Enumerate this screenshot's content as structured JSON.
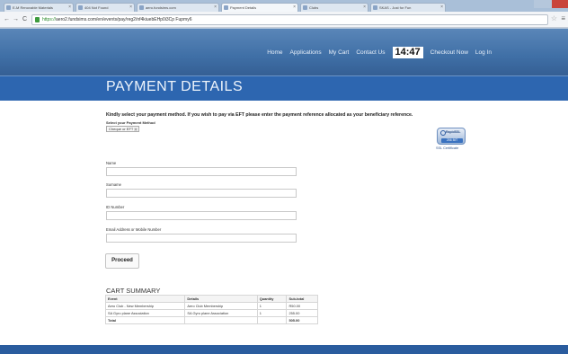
{
  "browser": {
    "tabs": [
      {
        "label": "E-M Renovable Materials",
        "active": false
      },
      {
        "label": "404 Not Found",
        "active": false
      },
      {
        "label": "aero.fundsims.com",
        "active": false
      },
      {
        "label": "Payment Details",
        "active": true
      },
      {
        "label": "Clubs",
        "active": false
      },
      {
        "label": "SKAS - Just for Fun",
        "active": false
      }
    ],
    "url_scheme": "https://",
    "url_rest": "aero2.fundsims.com/en/events/pay/reg2/nf4kiuebEHp0i3Cp Fupmy6",
    "back": "←",
    "forward": "→",
    "reload": "C"
  },
  "site": {
    "nav": [
      "Home",
      "Applications",
      "My Cart",
      "Contact Us"
    ],
    "clock": "14:47",
    "nav_after": [
      "Checkout Now",
      "Log In"
    ]
  },
  "page": {
    "title": "PAYMENT DETAILS",
    "intro": "Kindly select your payment method. If you wish to pay via EFT please enter the payment reference allocated as your beneficiary reference.",
    "select_label": "Select your Payment Method",
    "select_value": "Cheque or EFT",
    "ssl_caption": "SSL Certificate",
    "ssl_brand": "RapidSSL",
    "ssl_badge": "256 BIT",
    "fields": [
      {
        "label": "Name",
        "value": ""
      },
      {
        "label": "Surname",
        "value": ""
      },
      {
        "label": "ID Number",
        "value": ""
      },
      {
        "label": "Email Address or Mobile Number",
        "value": ""
      }
    ],
    "proceed_label": "Proceed"
  },
  "cart": {
    "title": "CART SUMMARY",
    "headers": [
      "Event",
      "Details",
      "Quantity",
      "Sub-total"
    ],
    "rows": [
      [
        "Aero Club - New Membership",
        "Aero Club Membership",
        "1",
        "R50.00"
      ],
      [
        "SA Gyro plane Association",
        "SA Gyro plane Association",
        "1",
        "255.00"
      ]
    ],
    "total_label": "Total",
    "total_value": "505.00"
  }
}
